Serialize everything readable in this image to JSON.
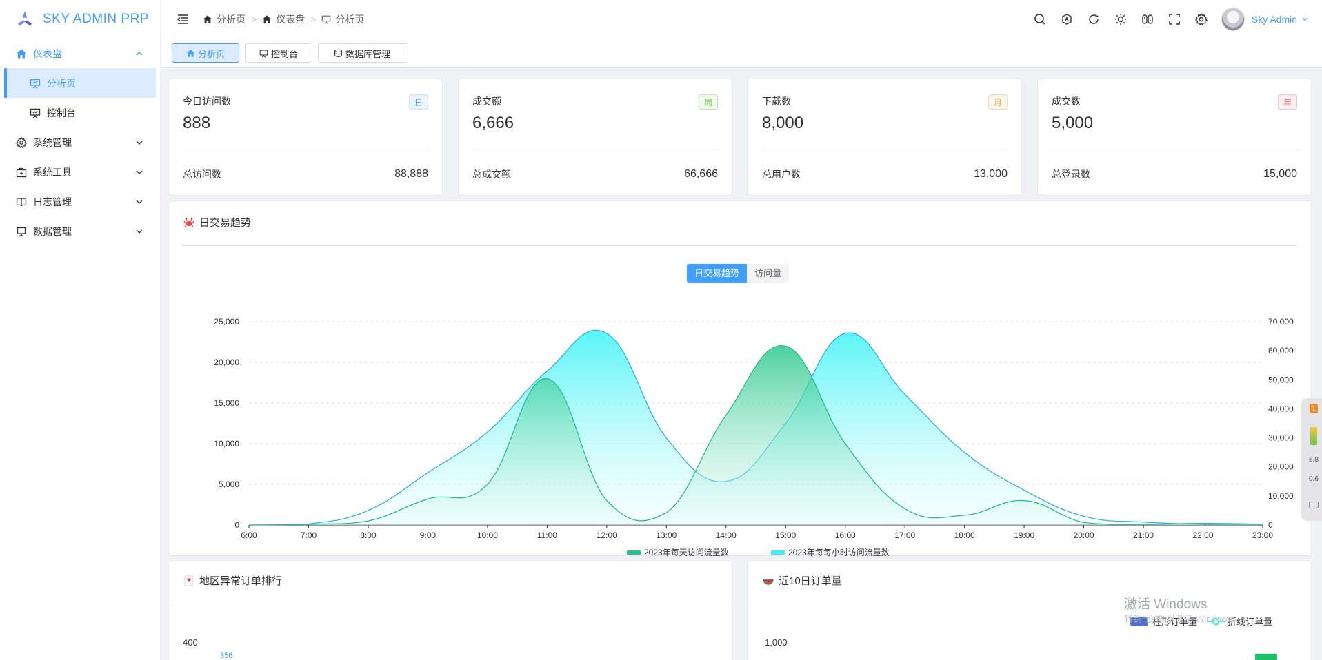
{
  "app": {
    "title": "SKY ADMIN PRP"
  },
  "sidebar": {
    "items": [
      {
        "label": "仪表盘",
        "icon": "home-icon"
      },
      {
        "label": "分析页",
        "icon": "presentation-icon"
      },
      {
        "label": "控制台",
        "icon": "presentation-chart-icon"
      },
      {
        "label": "系统管理",
        "icon": "gear-icon"
      },
      {
        "label": "系统工具",
        "icon": "toolbox-icon"
      },
      {
        "label": "日志管理",
        "icon": "book-icon"
      },
      {
        "label": "数据管理",
        "icon": "board-icon"
      }
    ]
  },
  "header": {
    "breadcrumb": [
      "分析页",
      "仪表盘",
      "分析页"
    ],
    "user": "Sky Admin"
  },
  "tabs": [
    "分析页",
    "控制台",
    "数据库管理"
  ],
  "stats": [
    {
      "title": "今日访问数",
      "value": "888",
      "badge": "日",
      "foot_label": "总访问数",
      "foot_value": "88,888",
      "badge_color": "#409eff",
      "badge_bg": "#ecf5ff"
    },
    {
      "title": "成交额",
      "value": "6,666",
      "badge": "周",
      "foot_label": "总成交额",
      "foot_value": "66,666",
      "badge_color": "#67c23a",
      "badge_bg": "#f0f9eb"
    },
    {
      "title": "下载数",
      "value": "8,000",
      "badge": "月",
      "foot_label": "总用户数",
      "foot_value": "13,000",
      "badge_color": "#e6a23c",
      "badge_bg": "#fdf6ec"
    },
    {
      "title": "成交数",
      "value": "5,000",
      "badge": "年",
      "foot_label": "总登录数",
      "foot_value": "15,000",
      "badge_color": "#f56c6c",
      "badge_bg": "#fef0f0"
    }
  ],
  "trend_panel": {
    "title": "日交易趋势",
    "toggle": [
      "日交易趋势",
      "访问量"
    ]
  },
  "bottom_left": {
    "title": "地区异常订单排行",
    "y_top": "400",
    "bar_label": "356"
  },
  "bottom_right": {
    "title": "近10日订单量",
    "y_top": "1,000",
    "legend": [
      "柱形订单量",
      "折线订单量"
    ]
  },
  "watermark": {
    "line1": "激活 Windows",
    "line2": "转到\"设置\"以激活 Windows。"
  },
  "side_widget": {
    "v1": "5.8",
    "v2": "0.6"
  },
  "chart_data": {
    "type": "area",
    "x": [
      "6:00",
      "7:00",
      "8:00",
      "9:00",
      "10:00",
      "11:00",
      "12:00",
      "13:00",
      "14:00",
      "15:00",
      "16:00",
      "17:00",
      "18:00",
      "19:00",
      "20:00",
      "21:00",
      "22:00",
      "23:00"
    ],
    "ylim_left": [
      0,
      25000
    ],
    "yticks_left": [
      "0",
      "5,000",
      "10,000",
      "15,000",
      "20,000",
      "25,000"
    ],
    "ylim_right": [
      0,
      70000
    ],
    "yticks_right": [
      "0",
      "10,000",
      "20,000",
      "30,000",
      "40,000",
      "50,000",
      "60,000",
      "70,000"
    ],
    "grid": true,
    "legend_position": "bottom",
    "series": [
      {
        "name": "2023年每天访问流量数",
        "axis": "left",
        "color": "#1ec98a",
        "values": [
          0,
          100,
          500,
          3200,
          5000,
          18000,
          3000,
          1500,
          13500,
          22000,
          10000,
          2000,
          1200,
          3000,
          300,
          100,
          200,
          100
        ]
      },
      {
        "name": "2023年每每小时访问流量数",
        "axis": "right",
        "color": "#3af0f2",
        "values": [
          0,
          400,
          5000,
          18000,
          32000,
          53000,
          66000,
          30000,
          15000,
          35000,
          66000,
          45000,
          25000,
          12000,
          3000,
          1000,
          300,
          200
        ]
      }
    ]
  }
}
